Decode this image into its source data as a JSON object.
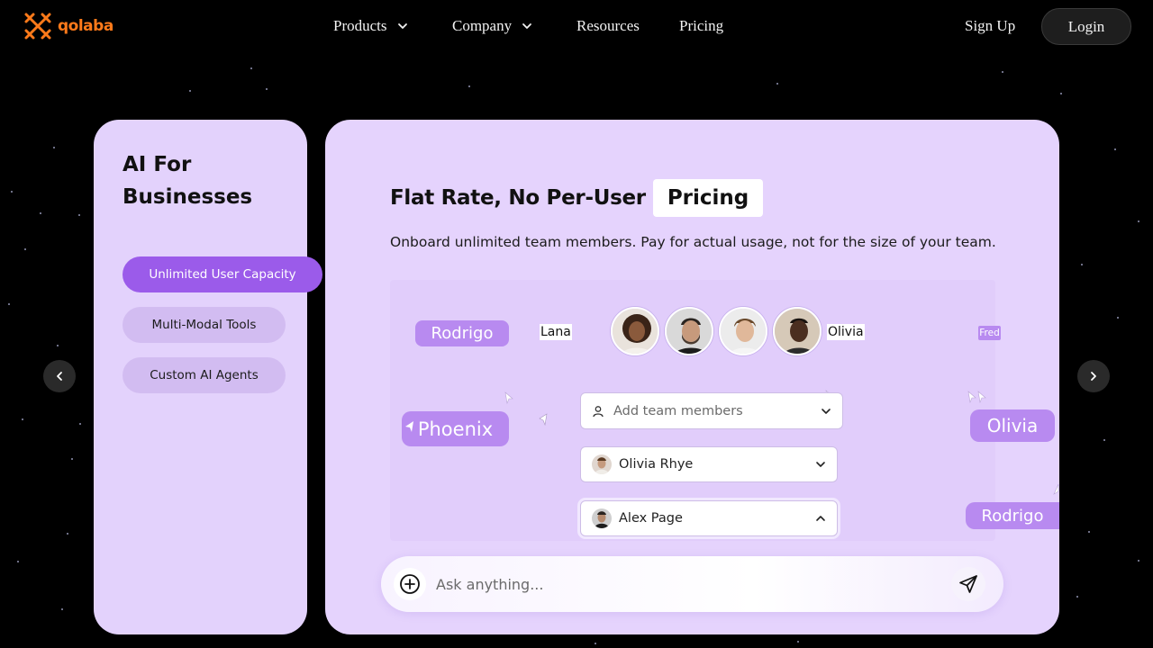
{
  "nav": {
    "logo_text": "qolaba",
    "links": [
      {
        "label": "Products",
        "has_dropdown": true
      },
      {
        "label": "Company",
        "has_dropdown": true
      },
      {
        "label": "Resources",
        "has_dropdown": false
      },
      {
        "label": "Pricing",
        "has_dropdown": false
      }
    ],
    "signup_label": "Sign Up",
    "login_label": "Login"
  },
  "colors": {
    "brand": "#ff7a1a",
    "accent": "#9b5bea",
    "card": "#e5d3fd",
    "tag": "#b88af0"
  },
  "left_card": {
    "title": "AI For Businesses",
    "items": [
      {
        "label": "Unlimited User Capacity",
        "active": true
      },
      {
        "label": "Multi-Modal Tools",
        "active": false
      },
      {
        "label": "Custom AI Agents",
        "active": false
      }
    ]
  },
  "main": {
    "headline_prefix": "Flat Rate, No Per-User",
    "headline_highlight": "Pricing",
    "subtitle": "Onboard unlimited team members. Pay for actual usage, not for the size of your team.",
    "floating_names": {
      "rodrigo_top": "Rodrigo",
      "lana": "Lana",
      "olivia_plain": "Olivia",
      "fred": "Fred",
      "phoenix": "Phoenix",
      "olivia_tag": "Olivia",
      "rodrigo_bottom": "Rodrigo"
    },
    "avatars": [
      "avatar-woman-curly-hair",
      "avatar-man-beard",
      "avatar-man-blond",
      "avatar-man-dark-skin"
    ],
    "add_members_placeholder": "Add team members",
    "member_selects": [
      {
        "name": "Olivia Rhye",
        "expanded": false
      },
      {
        "name": "Alex Page",
        "expanded": true
      }
    ],
    "ask_placeholder": "Ask anything..."
  }
}
